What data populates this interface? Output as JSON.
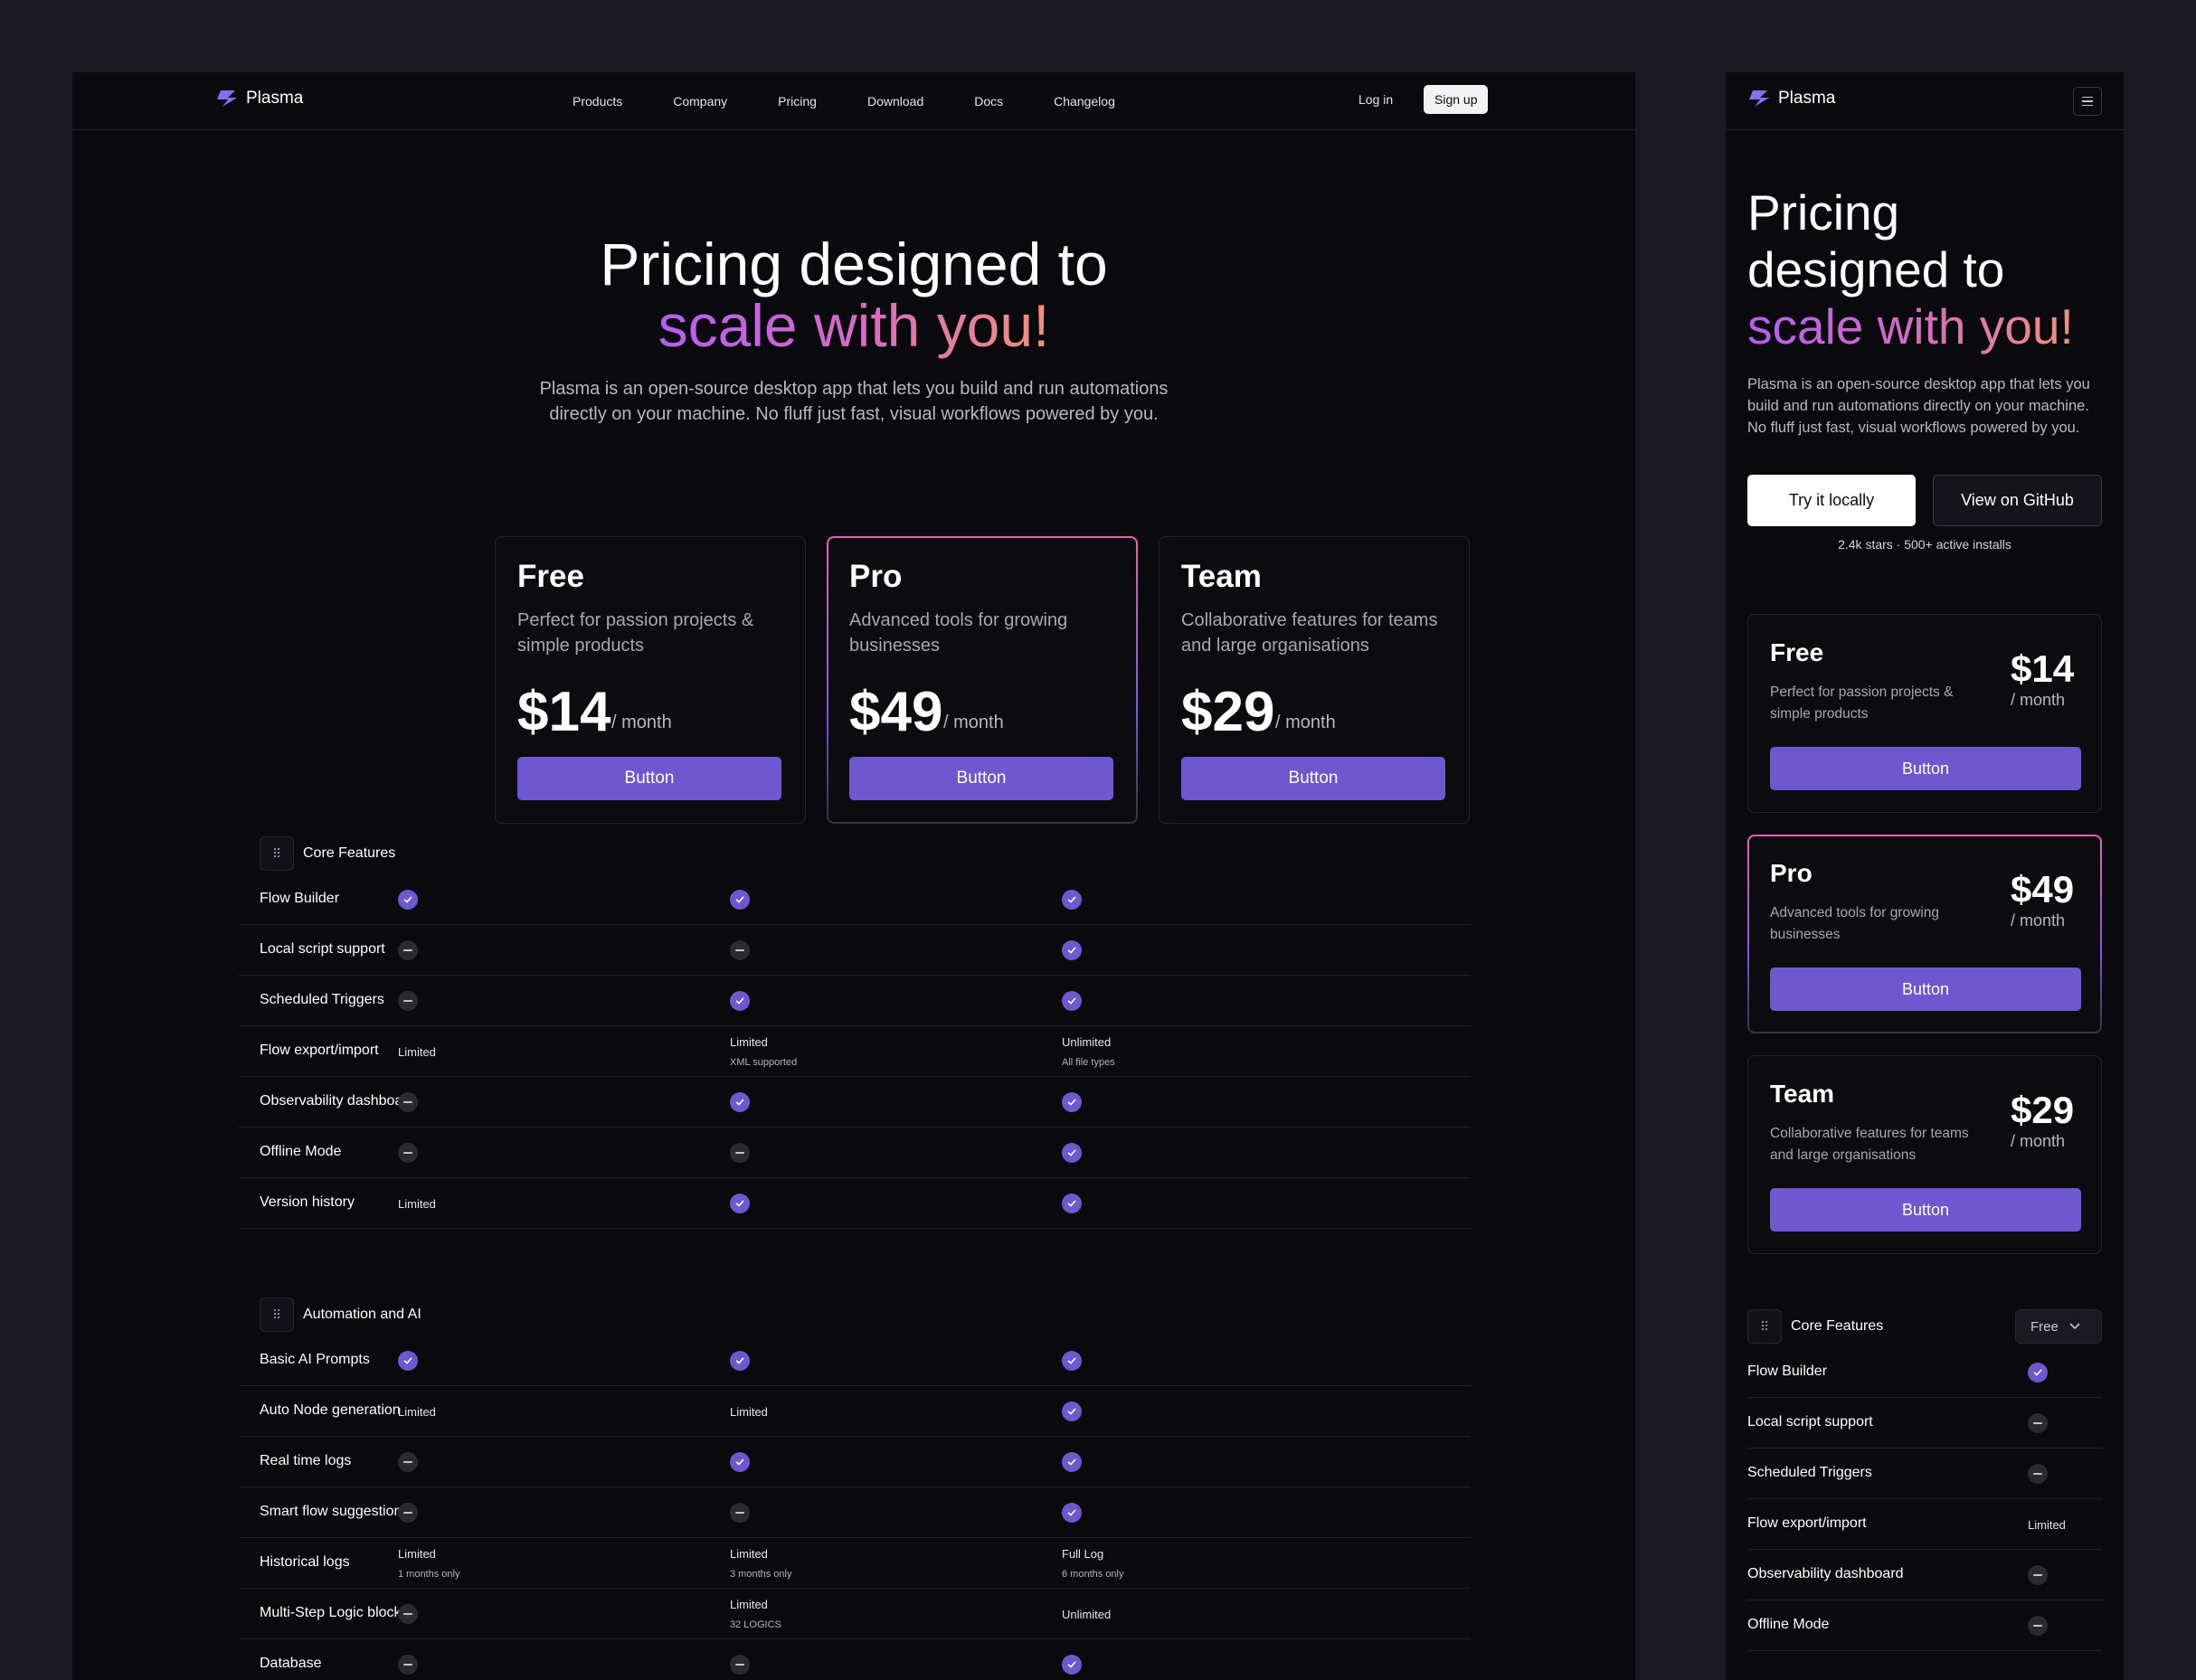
{
  "brand": "Plasma",
  "colors": {
    "accent": "#6e57cf",
    "background": "#0a090d",
    "gradient_start": "#b45ef3",
    "gradient_end": "#f0907a"
  },
  "nav": {
    "links": [
      "Products",
      "Company",
      "Pricing",
      "Download",
      "Docs",
      "Changelog"
    ],
    "login": "Log in",
    "signup": "Sign up"
  },
  "hero": {
    "title_line1": "Pricing designed to",
    "title_highlight": "scale with you!",
    "subtitle": "Plasma is an open-source desktop app that lets you build and run automations directly on your machine. No fluff just fast, visual workflows powered by you."
  },
  "plans": [
    {
      "name": "Free",
      "description": "Perfect for passion projects & simple products",
      "price": "$14",
      "period": "/ month",
      "button": "Button"
    },
    {
      "name": "Pro",
      "description": "Advanced tools for growing businesses",
      "price": "$49",
      "period": "/ month",
      "button": "Button"
    },
    {
      "name": "Team",
      "description": "Collaborative features for teams and large organisations",
      "price": "$29",
      "period": "/ month",
      "button": "Button"
    }
  ],
  "sections": [
    {
      "title": "Core Features",
      "rows": [
        {
          "name": "Flow Builder",
          "cells": [
            {
              "type": "check"
            },
            {
              "type": "check"
            },
            {
              "type": "check"
            }
          ]
        },
        {
          "name": "Local script support",
          "cells": [
            {
              "type": "dash"
            },
            {
              "type": "dash"
            },
            {
              "type": "check"
            }
          ]
        },
        {
          "name": "Scheduled Triggers",
          "cells": [
            {
              "type": "dash"
            },
            {
              "type": "check"
            },
            {
              "type": "check"
            }
          ]
        },
        {
          "name": "Flow export/import",
          "cells": [
            {
              "type": "text",
              "text": "Limited"
            },
            {
              "type": "text",
              "text": "Limited",
              "sub": "XML supported"
            },
            {
              "type": "text",
              "text": "Unlimited",
              "sub": "All file types"
            }
          ]
        },
        {
          "name": "Observability dashboard",
          "cells": [
            {
              "type": "dash"
            },
            {
              "type": "check"
            },
            {
              "type": "check"
            }
          ]
        },
        {
          "name": "Offline Mode",
          "cells": [
            {
              "type": "dash"
            },
            {
              "type": "dash"
            },
            {
              "type": "check"
            }
          ]
        },
        {
          "name": "Version history",
          "cells": [
            {
              "type": "text",
              "text": "Limited"
            },
            {
              "type": "check"
            },
            {
              "type": "check"
            }
          ]
        }
      ]
    },
    {
      "title": "Automation and AI",
      "rows": [
        {
          "name": "Basic AI Prompts",
          "cells": [
            {
              "type": "check"
            },
            {
              "type": "check"
            },
            {
              "type": "check"
            }
          ]
        },
        {
          "name": "Auto Node generation",
          "cells": [
            {
              "type": "text",
              "text": "Limited"
            },
            {
              "type": "text",
              "text": "Limited"
            },
            {
              "type": "check"
            }
          ]
        },
        {
          "name": "Real time logs",
          "cells": [
            {
              "type": "dash"
            },
            {
              "type": "check"
            },
            {
              "type": "check"
            }
          ]
        },
        {
          "name": "Smart flow suggestions",
          "cells": [
            {
              "type": "dash"
            },
            {
              "type": "dash"
            },
            {
              "type": "check"
            }
          ]
        },
        {
          "name": "Historical logs",
          "cells": [
            {
              "type": "text",
              "text": "Limited",
              "sub": "1 months only"
            },
            {
              "type": "text",
              "text": "Limited",
              "sub": "3 months only"
            },
            {
              "type": "text",
              "text": "Full Log",
              "sub": "6 months only"
            }
          ]
        },
        {
          "name": "Multi-Step Logic blocks",
          "cells": [
            {
              "type": "dash"
            },
            {
              "type": "text",
              "text": "Limited",
              "sub": "32 LOGICS"
            },
            {
              "type": "text",
              "text": "Unlimited"
            }
          ]
        },
        {
          "name": "Database",
          "cells": [
            {
              "type": "dash"
            },
            {
              "type": "dash"
            },
            {
              "type": "check"
            }
          ]
        }
      ]
    }
  ],
  "mobile": {
    "cta_primary": "Try it locally",
    "cta_secondary": "View on GitHub",
    "stats": "2.4k stars · 500+ active installs",
    "plan_select": "Free",
    "rows": [
      {
        "name": "Flow Builder",
        "cell": {
          "type": "check"
        }
      },
      {
        "name": "Local script support",
        "cell": {
          "type": "dash"
        }
      },
      {
        "name": "Scheduled Triggers",
        "cell": {
          "type": "dash"
        }
      },
      {
        "name": "Flow export/import",
        "cell": {
          "type": "text",
          "text": "Limited"
        }
      },
      {
        "name": "Observability dashboard",
        "cell": {
          "type": "dash"
        }
      },
      {
        "name": "Offline Mode",
        "cell": {
          "type": "dash"
        }
      }
    ]
  }
}
